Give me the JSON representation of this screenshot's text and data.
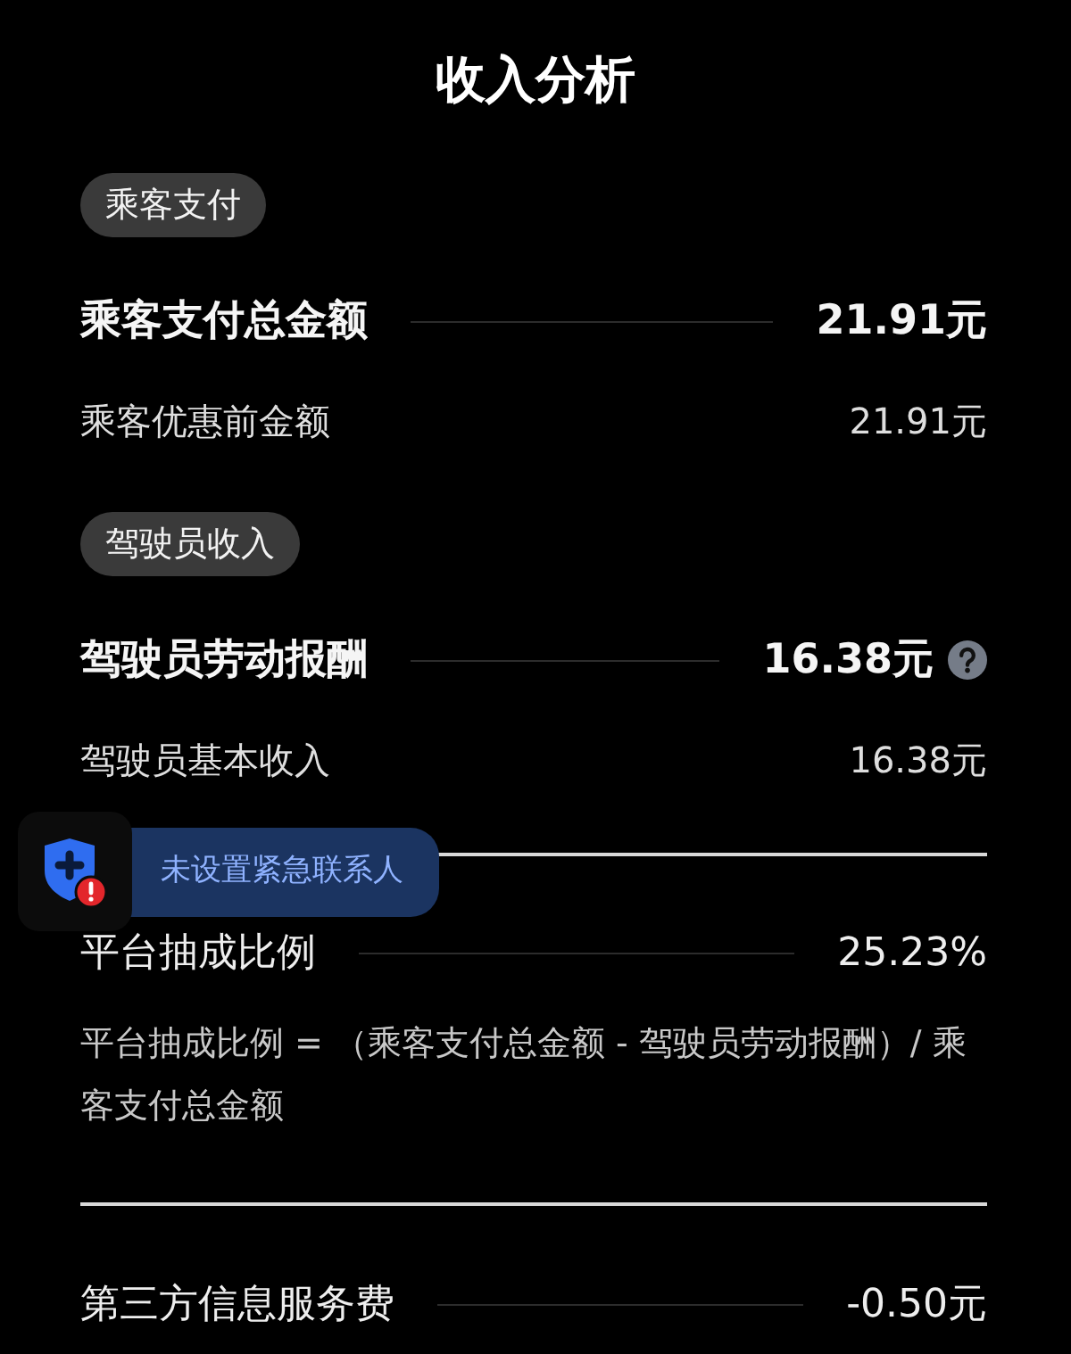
{
  "title": "收入分析",
  "items": [
    {
      "kind": "pill",
      "label": "乘客支付"
    },
    {
      "kind": "total",
      "label": "乘客支付总金额",
      "value": "21.91元",
      "help": false
    },
    {
      "kind": "detail",
      "label": "乘客优惠前金额",
      "value": "21.91元"
    },
    {
      "kind": "pill",
      "label": "驾驶员收入"
    },
    {
      "kind": "total",
      "label": "驾驶员劳动报酬",
      "value": "16.38元",
      "help": true
    },
    {
      "kind": "detail",
      "label": "驾驶员基本收入",
      "value": "16.38元"
    },
    {
      "kind": "divider"
    },
    {
      "kind": "stat",
      "label": "平台抽成比例",
      "value": "25.23%"
    },
    {
      "kind": "note",
      "text": "平台抽成比例 = （乘客支付总金额 - 驾驶员劳动报酬）/ 乘客支付总金额"
    },
    {
      "kind": "divider"
    },
    {
      "kind": "stat",
      "label": "第三方信息服务费",
      "value": "-0.50元"
    }
  ],
  "emergency_banner": {
    "text": "未设置紧急联系人"
  }
}
